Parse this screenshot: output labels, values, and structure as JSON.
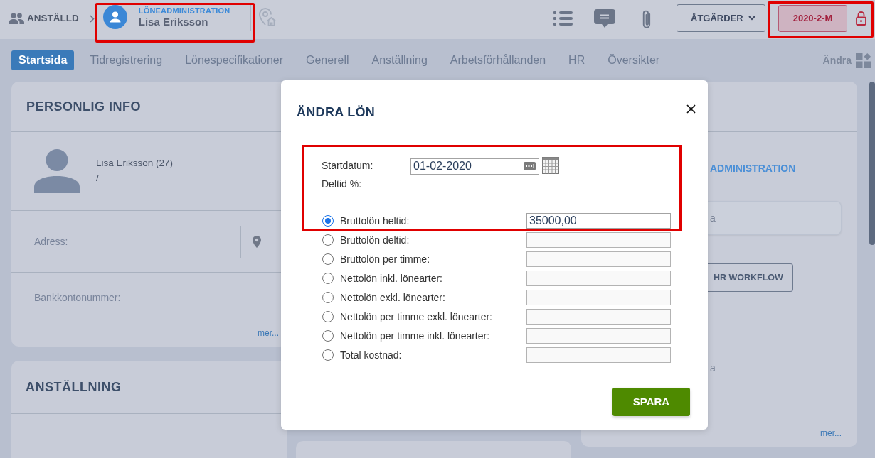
{
  "header": {
    "breadcrumb": "ANSTÄLLD",
    "employee": {
      "section": "LÖNEADMINISTRATION",
      "name": "Lisa Eriksson",
      "highlighted": true
    },
    "actions_button": "ÅTGÄRDER",
    "period": {
      "label": "2020-2-M",
      "highlighted": true
    }
  },
  "tabs": [
    {
      "label": "Startsida",
      "selected": true
    },
    {
      "label": "Tidregistrering",
      "selected": false
    },
    {
      "label": "Lönespecifikationer",
      "selected": false
    },
    {
      "label": "Generell",
      "selected": false
    },
    {
      "label": "Anställning",
      "selected": false
    },
    {
      "label": "Arbetsförhållanden",
      "selected": false
    },
    {
      "label": "HR",
      "selected": false
    },
    {
      "label": "Översikter",
      "selected": false
    }
  ],
  "edit_button": "Ändra",
  "personal_info": {
    "title": "PERSONLIG INFO",
    "name": "Lisa Eriksson (27)",
    "subline": "/",
    "fields": [
      {
        "label": "Adress:",
        "kind": "location"
      },
      {
        "label": "Bankkontonummer:",
        "kind": "plain"
      }
    ],
    "more_link": "mer..."
  },
  "employment": {
    "title": "ANSTÄLLNING"
  },
  "right_panel": {
    "heading": "ADMINISTRATION",
    "card_text": "a",
    "workflow_button": "HR WORKFLOW",
    "note": "a",
    "more_link": "mer..."
  },
  "modal": {
    "title": "ÄNDRA LÖN",
    "highlighted": true,
    "start_date": {
      "label": "Startdatum:",
      "value": "01-02-2020"
    },
    "part_time": {
      "label": "Deltid %:"
    },
    "options": [
      {
        "label": "Bruttolön heltid:",
        "selected": true,
        "value": "35000,00"
      },
      {
        "label": "Bruttolön deltid:",
        "selected": false
      },
      {
        "label": "Bruttolön per timme:",
        "selected": false
      },
      {
        "label": "Nettolön inkl. lönearter:",
        "selected": false
      },
      {
        "label": "Nettolön exkl. lönearter:",
        "selected": false
      },
      {
        "label": "Nettolön per timme exkl. lönearter:",
        "selected": false
      },
      {
        "label": "Nettolön per timme inkl. lönearter:",
        "selected": false
      },
      {
        "label": "Total kostnad:",
        "selected": false
      }
    ],
    "save_button": "SPARA"
  }
}
